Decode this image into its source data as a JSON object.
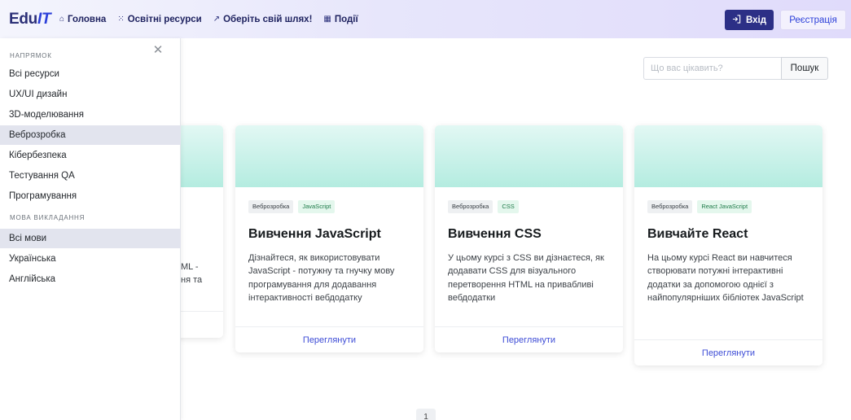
{
  "navbar": {
    "brand_main": "Edu",
    "brand_accent": "IT",
    "links": [
      {
        "icon": "home-icon",
        "glyph": "⌂",
        "label": "Головна"
      },
      {
        "icon": "grid-icon",
        "glyph": "⁙",
        "label": "Освітні ресурси"
      },
      {
        "icon": "trend-icon",
        "glyph": "↗",
        "label": "Оберіть свій шлях!"
      },
      {
        "icon": "calendar-icon",
        "glyph": "▦",
        "label": "Події"
      }
    ],
    "login_label": "Вхід",
    "register_label": "Реєстрація"
  },
  "search": {
    "placeholder": "Що вас цікавить?",
    "button_label": "Пошук"
  },
  "sidebar": {
    "direction_heading": "Напрямок",
    "directions": [
      "Всі ресурси",
      "UX/UI дизайн",
      "3D-моделювання",
      "Веброзробка",
      "Кібербезпека",
      "Тестування QA",
      "Програмування"
    ],
    "active_direction": "Веброзробка",
    "language_heading": "Мова викладання",
    "languages": [
      "Всі мови",
      "Українська",
      "Англійська"
    ],
    "active_language": "Всі мови"
  },
  "partial_card": {
    "text_fragments": [
      "ML -",
      "ня та"
    ]
  },
  "cards": [
    {
      "category": "Веброзробка",
      "tag": "JavaScript",
      "title": "Вивчення JavaScript",
      "text": "Дізнайтеся, як використовувати JavaScript - потужну та гнучку мову програмування для додавання інтерактивності вебдодатку",
      "link": "Переглянути"
    },
    {
      "category": "Веброзробка",
      "tag": "CSS",
      "title": "Вивчення CSS",
      "text": "У цьому курсі з CSS ви дізнаєтеся, як додавати CSS для візуального перетворення HTML на привабливі вебдодатки",
      "link": "Переглянути"
    },
    {
      "category": "Веброзробка",
      "tag": "React JavaScript",
      "title": "Вивчайте React",
      "text": "На цьому курсі React ви навчитеся створювати потужні інтерактивні додатки за допомогою однієї з найпопулярніших бібліотек JavaScript",
      "link": "Переглянути"
    }
  ],
  "pagination": {
    "current_page": "1"
  }
}
